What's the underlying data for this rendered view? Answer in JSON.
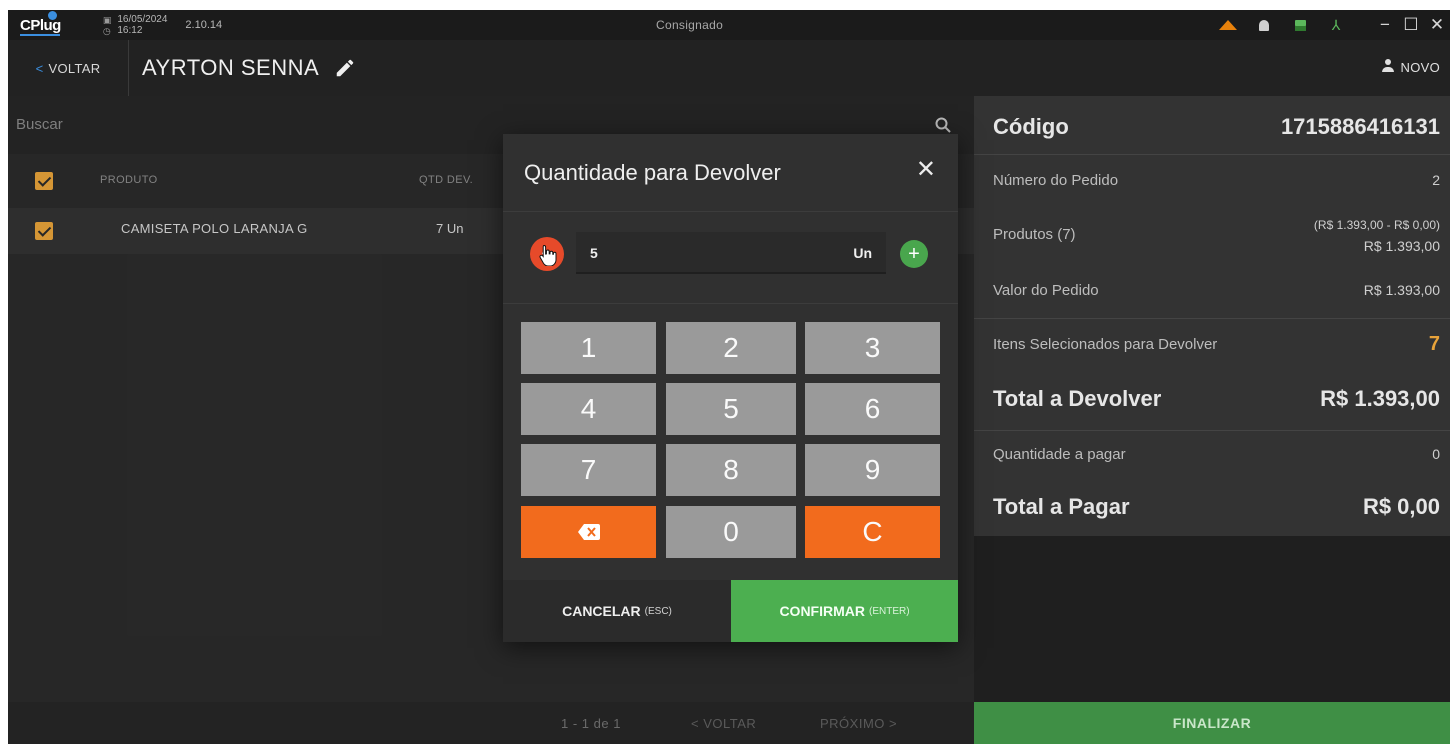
{
  "titlebar": {
    "logo": "CPlug",
    "date": "16/05/2024",
    "time": "16:12",
    "version": "2.10.14",
    "window_title": "Consignado",
    "icons": [
      "warning-icon",
      "bell-icon",
      "server-icon",
      "network-icon"
    ],
    "colors": {
      "warning": "#e8820c",
      "server": "#5cb85c"
    }
  },
  "navbar": {
    "back_label": "VOLTAR",
    "client_name": "AYRTON SENNA",
    "new_label": "NOVO"
  },
  "search": {
    "placeholder": "Buscar"
  },
  "table": {
    "headers": {
      "product": "PRODUTO",
      "qty": "QTD DEV."
    },
    "rows": [
      {
        "checked": true,
        "product": "CAMISETA POLO LARANJA G",
        "qty": "7 Un"
      }
    ]
  },
  "pagination": {
    "info": "1 - 1 de 1",
    "prev": "< VOLTAR",
    "next": "PRÓXIMO >"
  },
  "summary": {
    "code_label": "Código",
    "code_value": "1715886416131",
    "order_number_label": "Número do Pedido",
    "order_number_value": "2",
    "products_label": "Produtos (7)",
    "products_breakdown": "(R$ 1.393,00 - R$ 0,00)",
    "products_value": "R$ 1.393,00",
    "order_value_label": "Valor do Pedido",
    "order_value": "R$ 1.393,00",
    "selected_label": "Itens Selecionados para Devolver",
    "selected_value": "7",
    "total_return_label": "Total a Devolver",
    "total_return_value": "R$ 1.393,00",
    "qty_to_pay_label": "Quantidade a pagar",
    "qty_to_pay_value": "0",
    "total_pay_label": "Total a Pagar",
    "total_pay_value": "R$ 0,00",
    "finalize_label": "FINALIZAR"
  },
  "dialog": {
    "title": "Quantidade para Devolver",
    "quantity": "5",
    "unit": "Un",
    "keys": [
      "1",
      "2",
      "3",
      "4",
      "5",
      "6",
      "7",
      "8",
      "9",
      "",
      "0",
      "C"
    ],
    "cancel_label": "CANCELAR",
    "cancel_hint": "(ESC)",
    "confirm_label": "CONFIRMAR",
    "confirm_hint": "(ENTER)",
    "colors": {
      "accent_orange": "#f26b1d",
      "confirm_green": "#4caf50",
      "minus_red": "#e64a2a"
    }
  }
}
